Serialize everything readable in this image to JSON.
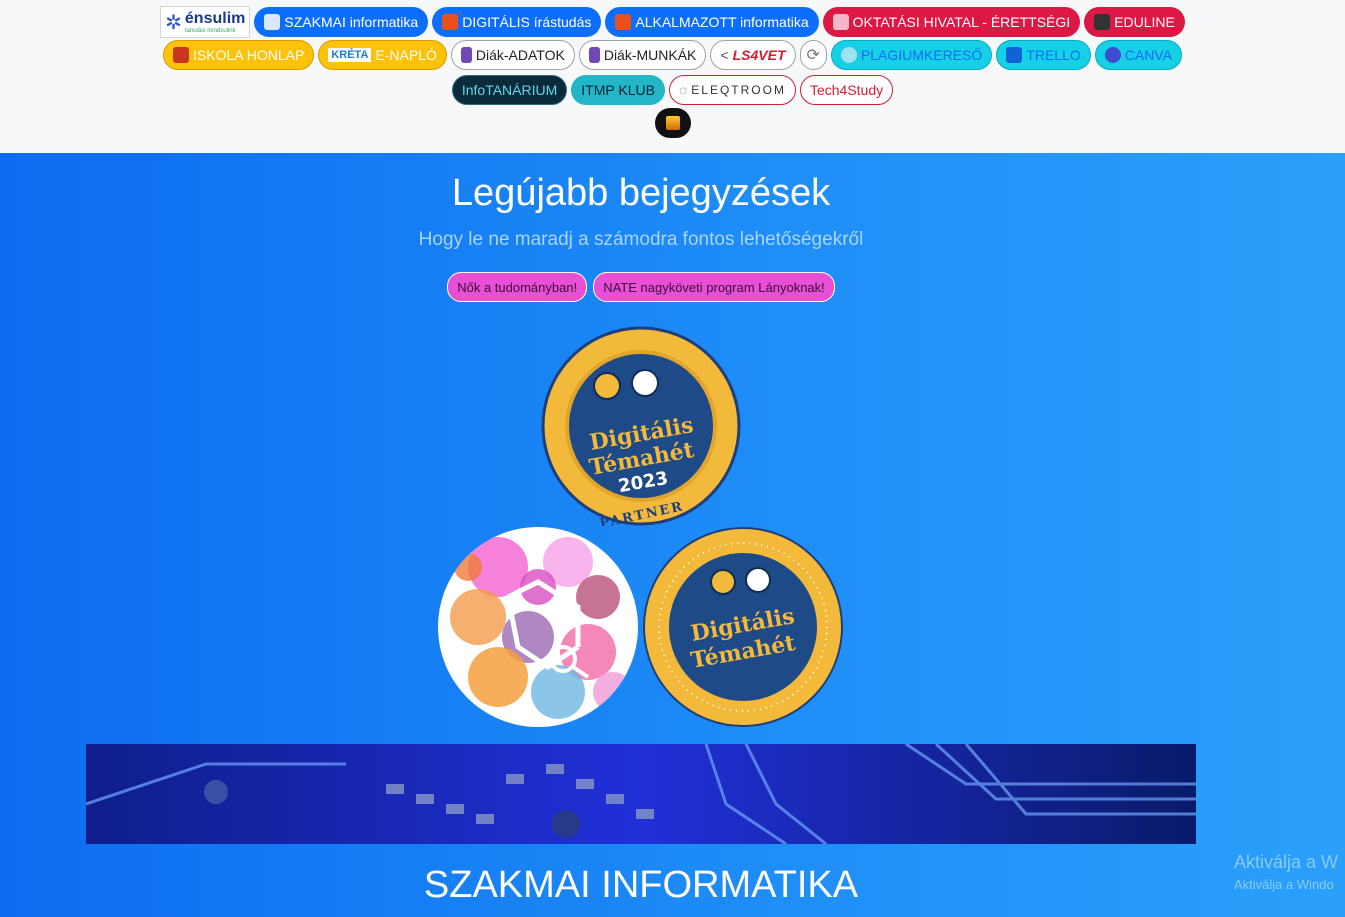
{
  "nav": {
    "ensulim": {
      "title": "énsulim",
      "tagline": "tanulási mindsulink"
    },
    "row1": [
      "SZAKMAI informatika",
      "DIGITÁLIS írástudás",
      "ALKALMAZOTT informatika",
      "OKTATÁSI HIVATAL - ÉRETTSÉGI",
      "EDULINE"
    ],
    "row2": [
      "ISKOLA HONLAP",
      "KRÉTA",
      "E-NAPLÓ",
      "Diák-ADATOK",
      "Diák-MUNKÁK",
      "LS4VET",
      "PLAGIUMKERESŐ",
      "TRELLO",
      "CANVA"
    ],
    "row3": [
      "InfoTANÁRIUM",
      "ITMP KLUB",
      "ELEQTROOM",
      "Tech4Study"
    ]
  },
  "main": {
    "title": "Legújabb bejegyzések",
    "subtitle": "Hogy le ne maradj a számodra fontos lehetőségekről",
    "pills": [
      "Nők a tudományban!",
      "NATE nagyköveti program Lányoknak!"
    ],
    "badge1": {
      "line1": "Digitális",
      "line2": "Témahét",
      "line3": "2023",
      "ribbon": "PARTNER"
    },
    "badge2": {
      "line1": "Digitális",
      "line2": "Témahét"
    },
    "section_title": "SZAKMAI INFORMATIKA"
  },
  "watermark": {
    "line1": "Aktiválja a W",
    "line2": "Aktiválja a Windo"
  }
}
